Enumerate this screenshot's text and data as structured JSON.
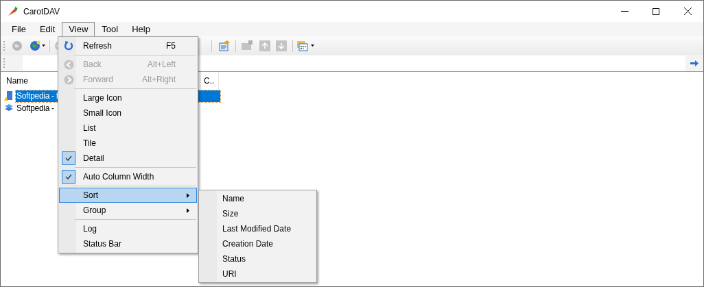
{
  "window": {
    "title": "CarotDAV"
  },
  "menu_bar": [
    {
      "label": "File",
      "selected": false
    },
    {
      "label": "Edit",
      "selected": false
    },
    {
      "label": "View",
      "selected": true
    },
    {
      "label": "Tool",
      "selected": false
    },
    {
      "label": "Help",
      "selected": false
    }
  ],
  "list": {
    "columns": [
      "Name",
      "C.."
    ],
    "rows": [
      {
        "name": "Softpedia - f",
        "selected": true
      },
      {
        "name": "Softpedia -",
        "selected": false
      }
    ]
  },
  "view_menu": [
    {
      "kind": "item",
      "label": "Refresh",
      "shortcut": "F5",
      "disabled": false,
      "checked": false,
      "submenu": false,
      "selected": false
    },
    {
      "kind": "separator"
    },
    {
      "kind": "item",
      "label": "Back",
      "shortcut": "Alt+Left",
      "disabled": true,
      "checked": false,
      "submenu": false,
      "selected": false
    },
    {
      "kind": "item",
      "label": "Forward",
      "shortcut": "Alt+Right",
      "disabled": true,
      "checked": false,
      "submenu": false,
      "selected": false
    },
    {
      "kind": "separator"
    },
    {
      "kind": "item",
      "label": "Large Icon",
      "disabled": false,
      "checked": false,
      "submenu": false,
      "selected": false
    },
    {
      "kind": "item",
      "label": "Small Icon",
      "disabled": false,
      "checked": false,
      "submenu": false,
      "selected": false
    },
    {
      "kind": "item",
      "label": "List",
      "disabled": false,
      "checked": false,
      "submenu": false,
      "selected": false
    },
    {
      "kind": "item",
      "label": "Tile",
      "disabled": false,
      "checked": false,
      "submenu": false,
      "selected": false
    },
    {
      "kind": "item",
      "label": "Detail",
      "disabled": false,
      "checked": true,
      "submenu": false,
      "selected": false
    },
    {
      "kind": "separator"
    },
    {
      "kind": "item",
      "label": "Auto Column Width",
      "disabled": false,
      "checked": true,
      "submenu": false,
      "selected": false
    },
    {
      "kind": "separator"
    },
    {
      "kind": "item",
      "label": "Sort",
      "disabled": false,
      "checked": false,
      "submenu": true,
      "selected": true
    },
    {
      "kind": "item",
      "label": "Group",
      "disabled": false,
      "checked": false,
      "submenu": true,
      "selected": false
    },
    {
      "kind": "separator"
    },
    {
      "kind": "item",
      "label": "Log",
      "disabled": false,
      "checked": false,
      "submenu": false,
      "selected": false
    },
    {
      "kind": "item",
      "label": "Status Bar",
      "disabled": false,
      "checked": false,
      "submenu": false,
      "selected": false
    }
  ],
  "sort_submenu": [
    "Name",
    "Size",
    "Last Modified Date",
    "Creation Date",
    "Status",
    "URI"
  ]
}
